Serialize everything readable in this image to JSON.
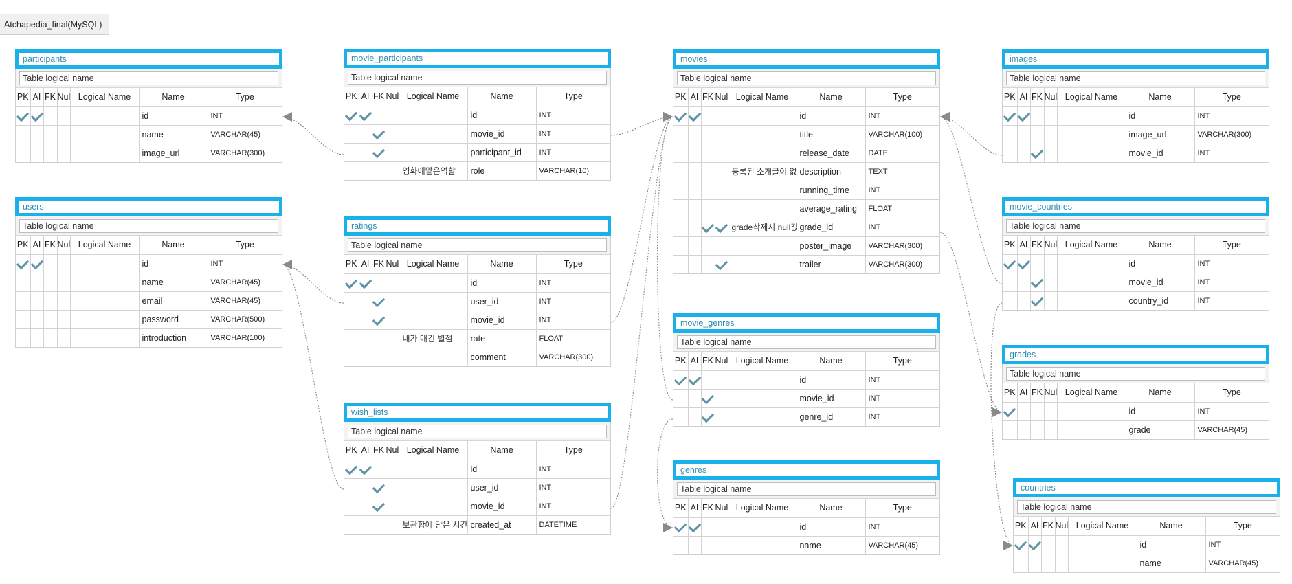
{
  "project": {
    "title": "Atchapedia_final(MySQL)"
  },
  "ui": {
    "logical_name_placeholder": "Table logical name",
    "headers": {
      "pk": "PK",
      "ai": "AI",
      "fk": "FK",
      "null": "Null",
      "logical": "Logical Name",
      "name": "Name",
      "type": "Type"
    }
  },
  "colors": {
    "table_header_border": "#1ab0ea",
    "table_title": "#2f8fb4",
    "check": "#5d93a4",
    "relation_line": "#888888"
  },
  "tables": [
    {
      "name": "participants",
      "columns": [
        {
          "pk": true,
          "ai": true,
          "fk": false,
          "null": false,
          "logical": "",
          "name": "id",
          "type": "INT"
        },
        {
          "pk": false,
          "ai": false,
          "fk": false,
          "null": false,
          "logical": "",
          "name": "name",
          "type": "VARCHAR(45)"
        },
        {
          "pk": false,
          "ai": false,
          "fk": false,
          "null": false,
          "logical": "",
          "name": "image_url",
          "type": "VARCHAR(300)"
        }
      ]
    },
    {
      "name": "users",
      "columns": [
        {
          "pk": true,
          "ai": true,
          "fk": false,
          "null": false,
          "logical": "",
          "name": "id",
          "type": "INT"
        },
        {
          "pk": false,
          "ai": false,
          "fk": false,
          "null": false,
          "logical": "",
          "name": "name",
          "type": "VARCHAR(45)"
        },
        {
          "pk": false,
          "ai": false,
          "fk": false,
          "null": false,
          "logical": "",
          "name": "email",
          "type": "VARCHAR(45)"
        },
        {
          "pk": false,
          "ai": false,
          "fk": false,
          "null": false,
          "logical": "",
          "name": "password",
          "type": "VARCHAR(500)"
        },
        {
          "pk": false,
          "ai": false,
          "fk": false,
          "null": false,
          "logical": "",
          "name": "introduction",
          "type": "VARCHAR(100)"
        }
      ]
    },
    {
      "name": "movie_participants",
      "columns": [
        {
          "pk": true,
          "ai": true,
          "fk": false,
          "null": false,
          "logical": "",
          "name": "id",
          "type": "INT"
        },
        {
          "pk": false,
          "ai": false,
          "fk": true,
          "null": false,
          "logical": "",
          "name": "movie_id",
          "type": "INT"
        },
        {
          "pk": false,
          "ai": false,
          "fk": true,
          "null": false,
          "logical": "",
          "name": "participant_id",
          "type": "INT"
        },
        {
          "pk": false,
          "ai": false,
          "fk": false,
          "null": false,
          "logical": "영화에맡은역할",
          "name": "role",
          "type": "VARCHAR(10)"
        }
      ]
    },
    {
      "name": "ratings",
      "columns": [
        {
          "pk": true,
          "ai": true,
          "fk": false,
          "null": false,
          "logical": "",
          "name": "id",
          "type": "INT"
        },
        {
          "pk": false,
          "ai": false,
          "fk": true,
          "null": false,
          "logical": "",
          "name": "user_id",
          "type": "INT"
        },
        {
          "pk": false,
          "ai": false,
          "fk": true,
          "null": false,
          "logical": "",
          "name": "movie_id",
          "type": "INT"
        },
        {
          "pk": false,
          "ai": false,
          "fk": false,
          "null": false,
          "logical": "내가 매긴 별점",
          "name": "rate",
          "type": "FLOAT"
        },
        {
          "pk": false,
          "ai": false,
          "fk": false,
          "null": false,
          "logical": "",
          "name": "comment",
          "type": "VARCHAR(300)"
        }
      ]
    },
    {
      "name": "wish_lists",
      "columns": [
        {
          "pk": true,
          "ai": true,
          "fk": false,
          "null": false,
          "logical": "",
          "name": "id",
          "type": "INT"
        },
        {
          "pk": false,
          "ai": false,
          "fk": true,
          "null": false,
          "logical": "",
          "name": "user_id",
          "type": "INT"
        },
        {
          "pk": false,
          "ai": false,
          "fk": true,
          "null": false,
          "logical": "",
          "name": "movie_id",
          "type": "INT"
        },
        {
          "pk": false,
          "ai": false,
          "fk": false,
          "null": false,
          "logical": "보관함에 담은 시간",
          "name": "created_at",
          "type": "DATETIME"
        }
      ]
    },
    {
      "name": "movies",
      "columns": [
        {
          "pk": true,
          "ai": true,
          "fk": false,
          "null": false,
          "logical": "",
          "name": "id",
          "type": "INT"
        },
        {
          "pk": false,
          "ai": false,
          "fk": false,
          "null": false,
          "logical": "",
          "name": "title",
          "type": "VARCHAR(100)"
        },
        {
          "pk": false,
          "ai": false,
          "fk": false,
          "null": false,
          "logical": "",
          "name": "release_date",
          "type": "DATE"
        },
        {
          "pk": false,
          "ai": false,
          "fk": false,
          "null": false,
          "logical": "등록된 소개글이 없",
          "name": "description",
          "type": "TEXT"
        },
        {
          "pk": false,
          "ai": false,
          "fk": false,
          "null": false,
          "logical": "",
          "name": "running_time",
          "type": "INT"
        },
        {
          "pk": false,
          "ai": false,
          "fk": false,
          "null": false,
          "logical": "",
          "name": "average_rating",
          "type": "FLOAT"
        },
        {
          "pk": false,
          "ai": false,
          "fk": true,
          "null": true,
          "logical": "grade삭제시 null값",
          "name": "grade_id",
          "type": "INT"
        },
        {
          "pk": false,
          "ai": false,
          "fk": false,
          "null": false,
          "logical": "",
          "name": "poster_image",
          "type": "VARCHAR(300)"
        },
        {
          "pk": false,
          "ai": false,
          "fk": false,
          "null": true,
          "logical": "",
          "name": "trailer",
          "type": "VARCHAR(300)"
        }
      ]
    },
    {
      "name": "movie_genres",
      "columns": [
        {
          "pk": true,
          "ai": true,
          "fk": false,
          "null": false,
          "logical": "",
          "name": "id",
          "type": "INT"
        },
        {
          "pk": false,
          "ai": false,
          "fk": true,
          "null": false,
          "logical": "",
          "name": "movie_id",
          "type": "INT"
        },
        {
          "pk": false,
          "ai": false,
          "fk": true,
          "null": false,
          "logical": "",
          "name": "genre_id",
          "type": "INT"
        }
      ]
    },
    {
      "name": "genres",
      "columns": [
        {
          "pk": true,
          "ai": true,
          "fk": false,
          "null": false,
          "logical": "",
          "name": "id",
          "type": "INT"
        },
        {
          "pk": false,
          "ai": false,
          "fk": false,
          "null": false,
          "logical": "",
          "name": "name",
          "type": "VARCHAR(45)"
        }
      ]
    },
    {
      "name": "images",
      "columns": [
        {
          "pk": true,
          "ai": true,
          "fk": false,
          "null": false,
          "logical": "",
          "name": "id",
          "type": "INT"
        },
        {
          "pk": false,
          "ai": false,
          "fk": false,
          "null": false,
          "logical": "",
          "name": "image_url",
          "type": "VARCHAR(300)"
        },
        {
          "pk": false,
          "ai": false,
          "fk": true,
          "null": false,
          "logical": "",
          "name": "movie_id",
          "type": "INT"
        }
      ]
    },
    {
      "name": "movie_countries",
      "columns": [
        {
          "pk": true,
          "ai": true,
          "fk": false,
          "null": false,
          "logical": "",
          "name": "id",
          "type": "INT"
        },
        {
          "pk": false,
          "ai": false,
          "fk": true,
          "null": false,
          "logical": "",
          "name": "movie_id",
          "type": "INT"
        },
        {
          "pk": false,
          "ai": false,
          "fk": true,
          "null": false,
          "logical": "",
          "name": "country_id",
          "type": "INT"
        }
      ]
    },
    {
      "name": "grades",
      "columns": [
        {
          "pk": true,
          "ai": false,
          "fk": false,
          "null": false,
          "logical": "",
          "name": "id",
          "type": "INT"
        },
        {
          "pk": false,
          "ai": false,
          "fk": false,
          "null": false,
          "logical": "",
          "name": "grade",
          "type": "VARCHAR(45)"
        }
      ]
    },
    {
      "name": "countries",
      "columns": [
        {
          "pk": true,
          "ai": true,
          "fk": false,
          "null": false,
          "logical": "",
          "name": "id",
          "type": "INT"
        },
        {
          "pk": false,
          "ai": false,
          "fk": false,
          "null": false,
          "logical": "",
          "name": "name",
          "type": "VARCHAR(45)"
        }
      ]
    }
  ],
  "relations": [
    {
      "from": "movie_participants.participant_id",
      "to": "participants.id"
    },
    {
      "from": "movie_participants.movie_id",
      "to": "movies.id"
    },
    {
      "from": "ratings.user_id",
      "to": "users.id"
    },
    {
      "from": "ratings.movie_id",
      "to": "movies.id"
    },
    {
      "from": "wish_lists.user_id",
      "to": "users.id"
    },
    {
      "from": "wish_lists.movie_id",
      "to": "movies.id"
    },
    {
      "from": "movie_genres.movie_id",
      "to": "movies.id"
    },
    {
      "from": "movie_genres.genre_id",
      "to": "genres.id"
    },
    {
      "from": "images.movie_id",
      "to": "movies.id"
    },
    {
      "from": "movie_countries.movie_id",
      "to": "movies.id"
    },
    {
      "from": "movie_countries.country_id",
      "to": "countries.id"
    },
    {
      "from": "movies.grade_id",
      "to": "grades.id"
    }
  ]
}
